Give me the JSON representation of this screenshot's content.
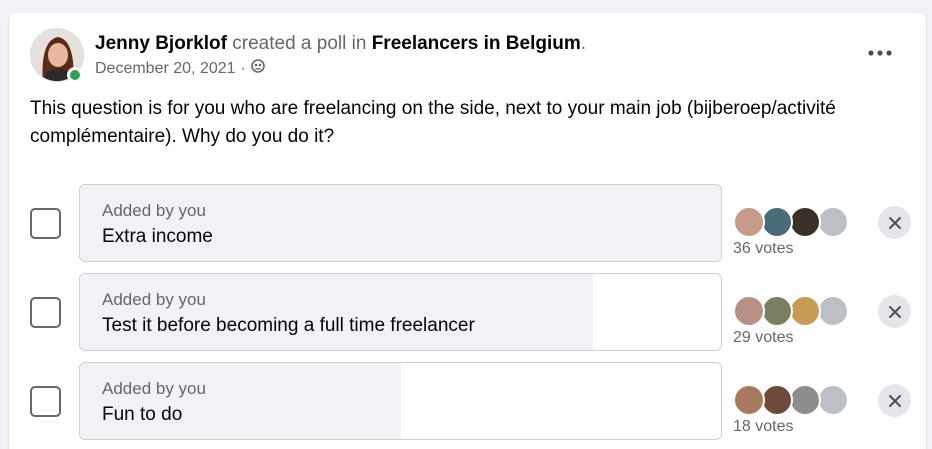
{
  "post": {
    "author": "Jenny Bjorklof",
    "action": " created a poll in ",
    "group": "Freelancers in Belgium",
    "period": ".",
    "date": "December 20, 2021",
    "separator": "·",
    "audience_icon": "group-audience-icon",
    "more_icon": "more-dots-icon",
    "question": "This question is for you who are freelancing on the side, next to your main job (bijberoep/activité complémentaire). Why do you do it?"
  },
  "poll": {
    "options": [
      {
        "added_by": "Added by you",
        "text": "Extra income",
        "votes": "36 votes",
        "vote_share": 1.0,
        "voter_colors": [
          "#c89a8a",
          "#4a6b78",
          "#3a3028",
          "#bcc0c4"
        ]
      },
      {
        "added_by": "Added by you",
        "text": "Test it before becoming a full time freelancer",
        "votes": "29 votes",
        "vote_share": 0.8,
        "voter_colors": [
          "#b98f86",
          "#7b7f62",
          "#c79a55",
          "#bcc0c4"
        ]
      },
      {
        "added_by": "Added by you",
        "text": "Fun to do",
        "votes": "18 votes",
        "vote_share": 0.5,
        "voter_colors": [
          "#a8785f",
          "#6e4a3a",
          "#8d8d8d",
          "#bcc0c4"
        ]
      }
    ]
  },
  "colors": {
    "online": "#31a24c",
    "bar_fill": "#f0f2f5",
    "secondary_text": "#65676b"
  }
}
